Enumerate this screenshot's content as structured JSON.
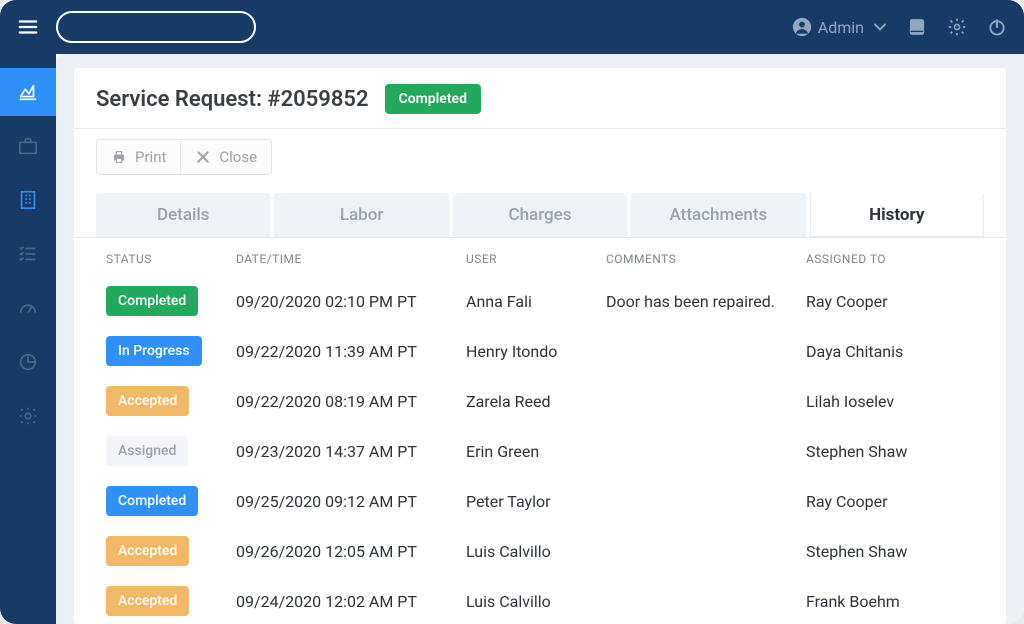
{
  "topbar": {
    "admin_label": "Admin",
    "search_placeholder": ""
  },
  "page": {
    "title_prefix": "Service Request: ",
    "request_id": "#2059852",
    "status_label": "Completed"
  },
  "toolbar": {
    "print_label": "Print",
    "close_label": "Close"
  },
  "tabs": {
    "items": [
      "Details",
      "Labor",
      "Charges",
      "Attachments",
      "History"
    ],
    "active_index": 4
  },
  "table": {
    "columns": [
      "STATUS",
      "DATE/TIME",
      "USER",
      "COMMENTS",
      "ASSIGNED TO"
    ],
    "rows": [
      {
        "status": "Completed",
        "status_class": "status-completed",
        "datetime": "09/20/2020 02:10 PM PT",
        "user": "Anna Fali",
        "comments": "Door has been repaired.",
        "assigned_to": "Ray Cooper"
      },
      {
        "status": "In Progress",
        "status_class": "status-in-progress",
        "datetime": "09/22/2020 11:39 AM PT",
        "user": "Henry Itondo",
        "comments": "",
        "assigned_to": "Daya Chitanis"
      },
      {
        "status": "Accepted",
        "status_class": "status-accepted",
        "datetime": "09/22/2020 08:19 AM PT",
        "user": "Zarela Reed",
        "comments": "",
        "assigned_to": "Lilah Ioselev"
      },
      {
        "status": "Assigned",
        "status_class": "status-assigned",
        "datetime": "09/23/2020 14:37 AM PT",
        "user": "Erin Green",
        "comments": "",
        "assigned_to": "Stephen Shaw"
      },
      {
        "status": "Completed",
        "status_class": "status-completed-blue",
        "datetime": "09/25/2020 09:12 AM PT",
        "user": "Peter Taylor",
        "comments": "",
        "assigned_to": "Ray Cooper"
      },
      {
        "status": "Accepted",
        "status_class": "status-accepted",
        "datetime": "09/26/2020 12:05 AM PT",
        "user": "Luis Calvillo",
        "comments": "",
        "assigned_to": "Stephen Shaw"
      },
      {
        "status": "Accepted",
        "status_class": "status-accepted",
        "datetime": "09/24/2020 12:02 AM PT",
        "user": "Luis Calvillo",
        "comments": "",
        "assigned_to": "Frank Boehm"
      }
    ]
  }
}
